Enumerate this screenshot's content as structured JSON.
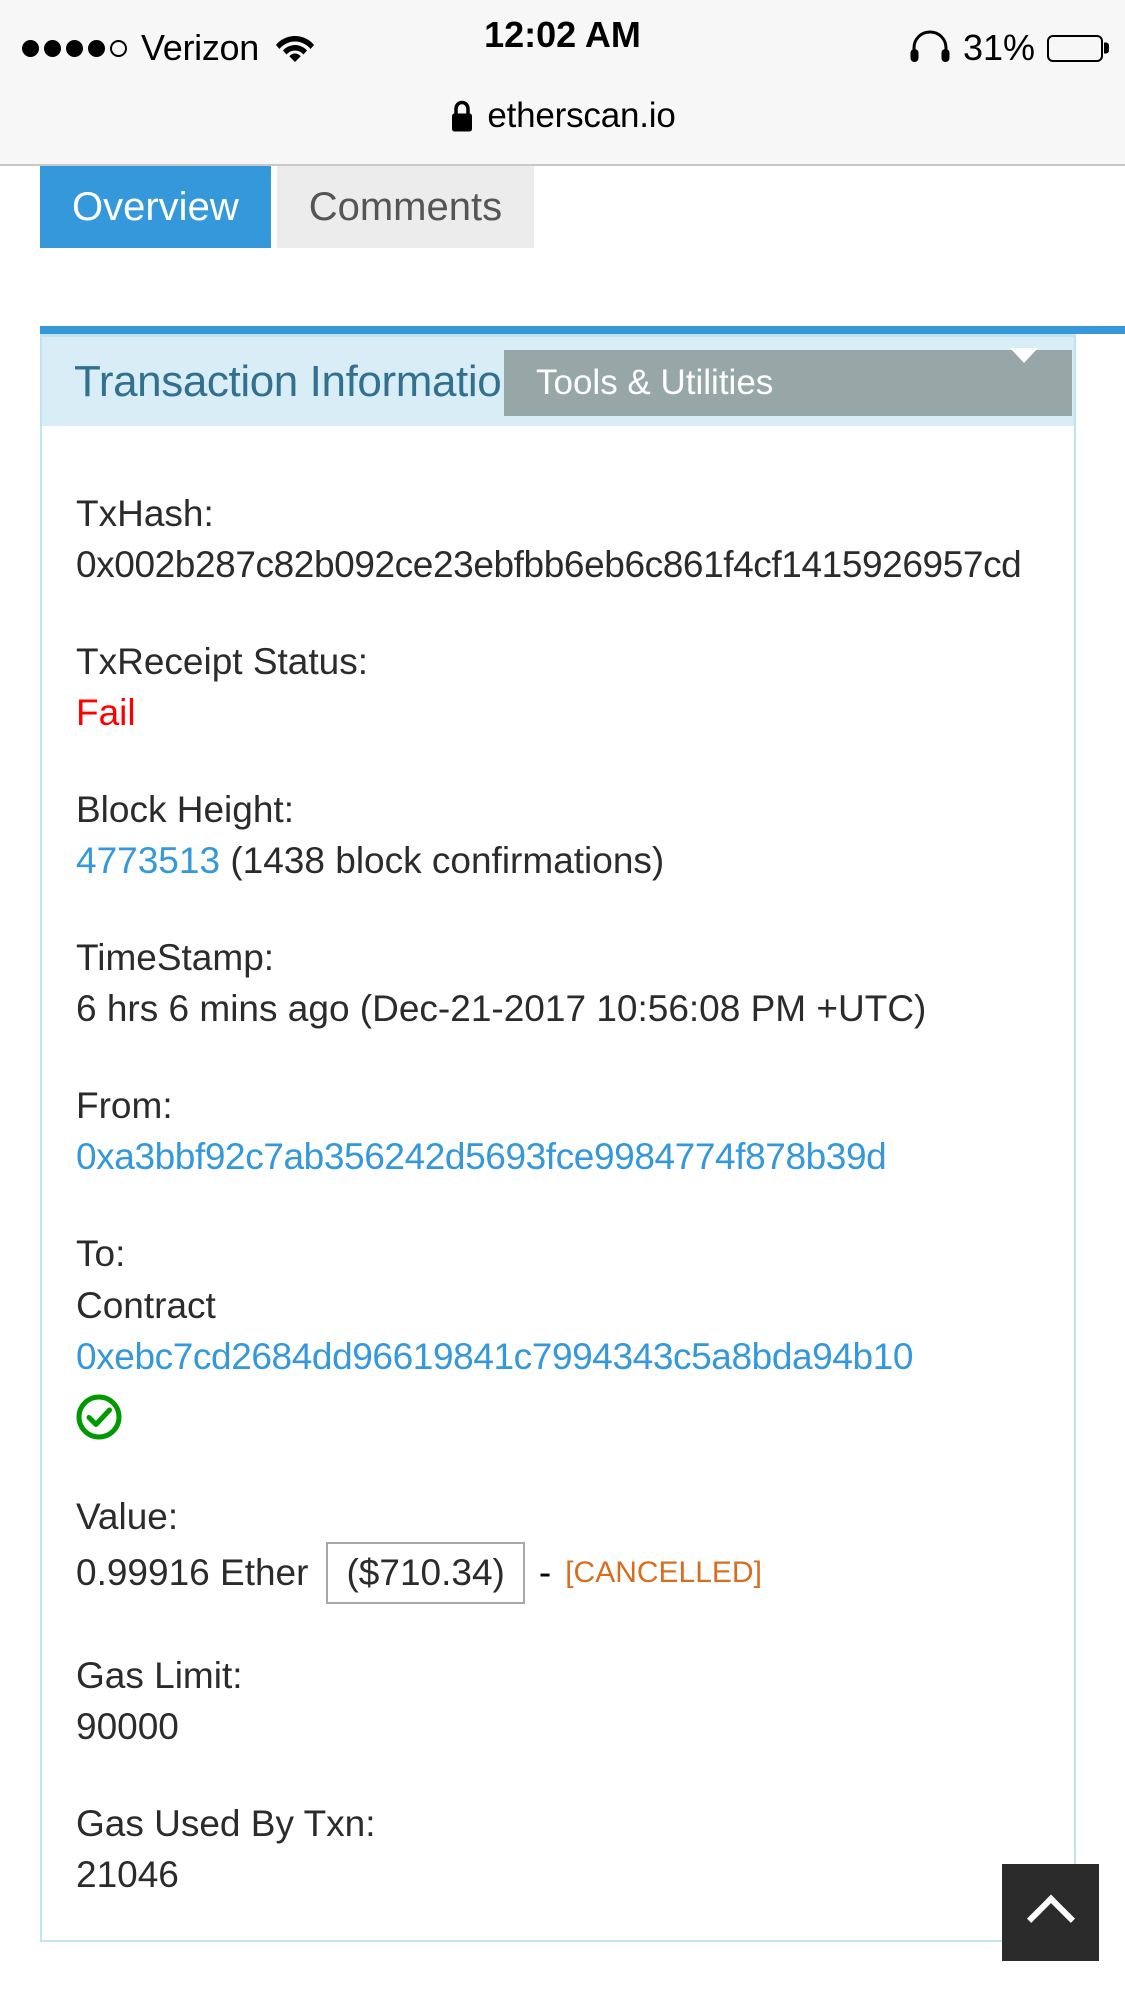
{
  "status_bar": {
    "carrier": "Verizon",
    "signal_dots_filled": 4,
    "signal_dots_total": 5,
    "wifi_icon": "wifi-icon",
    "time": "12:02 AM",
    "headphones_icon": "headphones-icon",
    "battery_percent": "31%",
    "battery_level": 31,
    "battery_color": "#ffcc00"
  },
  "browser": {
    "lock_icon": "lock-icon",
    "url": "etherscan.io"
  },
  "tabs": [
    {
      "label": "Overview",
      "active": true
    },
    {
      "label": "Comments",
      "active": false
    }
  ],
  "panel": {
    "title": "Transaction Information",
    "tools_button": {
      "label": "Tools & Utilities",
      "caret_icon": "chevron-down-icon"
    },
    "accent_color": "#3498db",
    "header_bg": "#d9edf7",
    "title_color": "#31708f"
  },
  "fields": {
    "txhash": {
      "label": "TxHash:",
      "value": "0x002b287c82b092ce23ebfbb6eb6c861f4cf1415926957cd"
    },
    "txreceipt_status": {
      "label": "TxReceipt Status:",
      "value": "Fail",
      "color": "#ff0000"
    },
    "block_height": {
      "label": "Block Height:",
      "value": "4773513",
      "confirmations": "(1438 block confirmations)"
    },
    "timestamp": {
      "label": "TimeStamp:",
      "value": "6 hrs 6 mins ago (Dec-21-2017 10:56:08 PM +UTC)"
    },
    "from": {
      "label": "From:",
      "value": "0xa3bbf92c7ab356242d5693fce9984774f878b39d"
    },
    "to": {
      "label": "To:",
      "kind": "Contract",
      "value": "0xebc7cd2684dd96619841c7994343c5a8bda94b10",
      "verified_icon": "verified-check-icon",
      "verified_color": "#009900"
    },
    "value": {
      "label": "Value:",
      "ether": "0.99916 Ether",
      "usd": "($710.34)",
      "separator": "-",
      "tag": "[CANCELLED]",
      "tag_color": "#d96d1f"
    },
    "gas_limit": {
      "label": "Gas Limit:",
      "value": "90000"
    },
    "gas_used": {
      "label": "Gas Used By Txn:",
      "value": "21046"
    }
  },
  "scroll_top_button": {
    "icon": "chevron-up-icon"
  }
}
